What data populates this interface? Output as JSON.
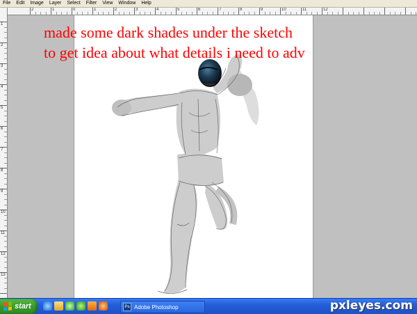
{
  "menu": [
    "File",
    "Edit",
    "Image",
    "Layer",
    "Select",
    "Filter",
    "View",
    "Window",
    "Help"
  ],
  "ruler_top": [
    "2",
    "1",
    "0",
    "1",
    "2",
    "3",
    "4",
    "5",
    "6",
    "7",
    "8",
    "9",
    "10",
    "11",
    "12"
  ],
  "ruler_left": [
    "1",
    "2",
    "3",
    "4",
    "5",
    "6",
    "7",
    "8",
    "9",
    "10",
    "11",
    "12",
    "13"
  ],
  "annotation": {
    "line1": "made some dark shades under the sketch",
    "line2": "to get idea about what details i need to adv"
  },
  "taskbar": {
    "start_label": "start",
    "task_label": "Adobe Photoshop",
    "quicklaunch": [
      "ie-icon",
      "folder-icon",
      "media-icon",
      "messenger-icon",
      "vlc-icon",
      "firefox-icon"
    ]
  },
  "watermark": "pxleyes.com",
  "colors": {
    "annotation": "#ff0000",
    "taskbar": "#245edb",
    "start": "#3a9a2b",
    "canvas_bg": "#ffffff",
    "workspace": "#c0c0c0"
  }
}
